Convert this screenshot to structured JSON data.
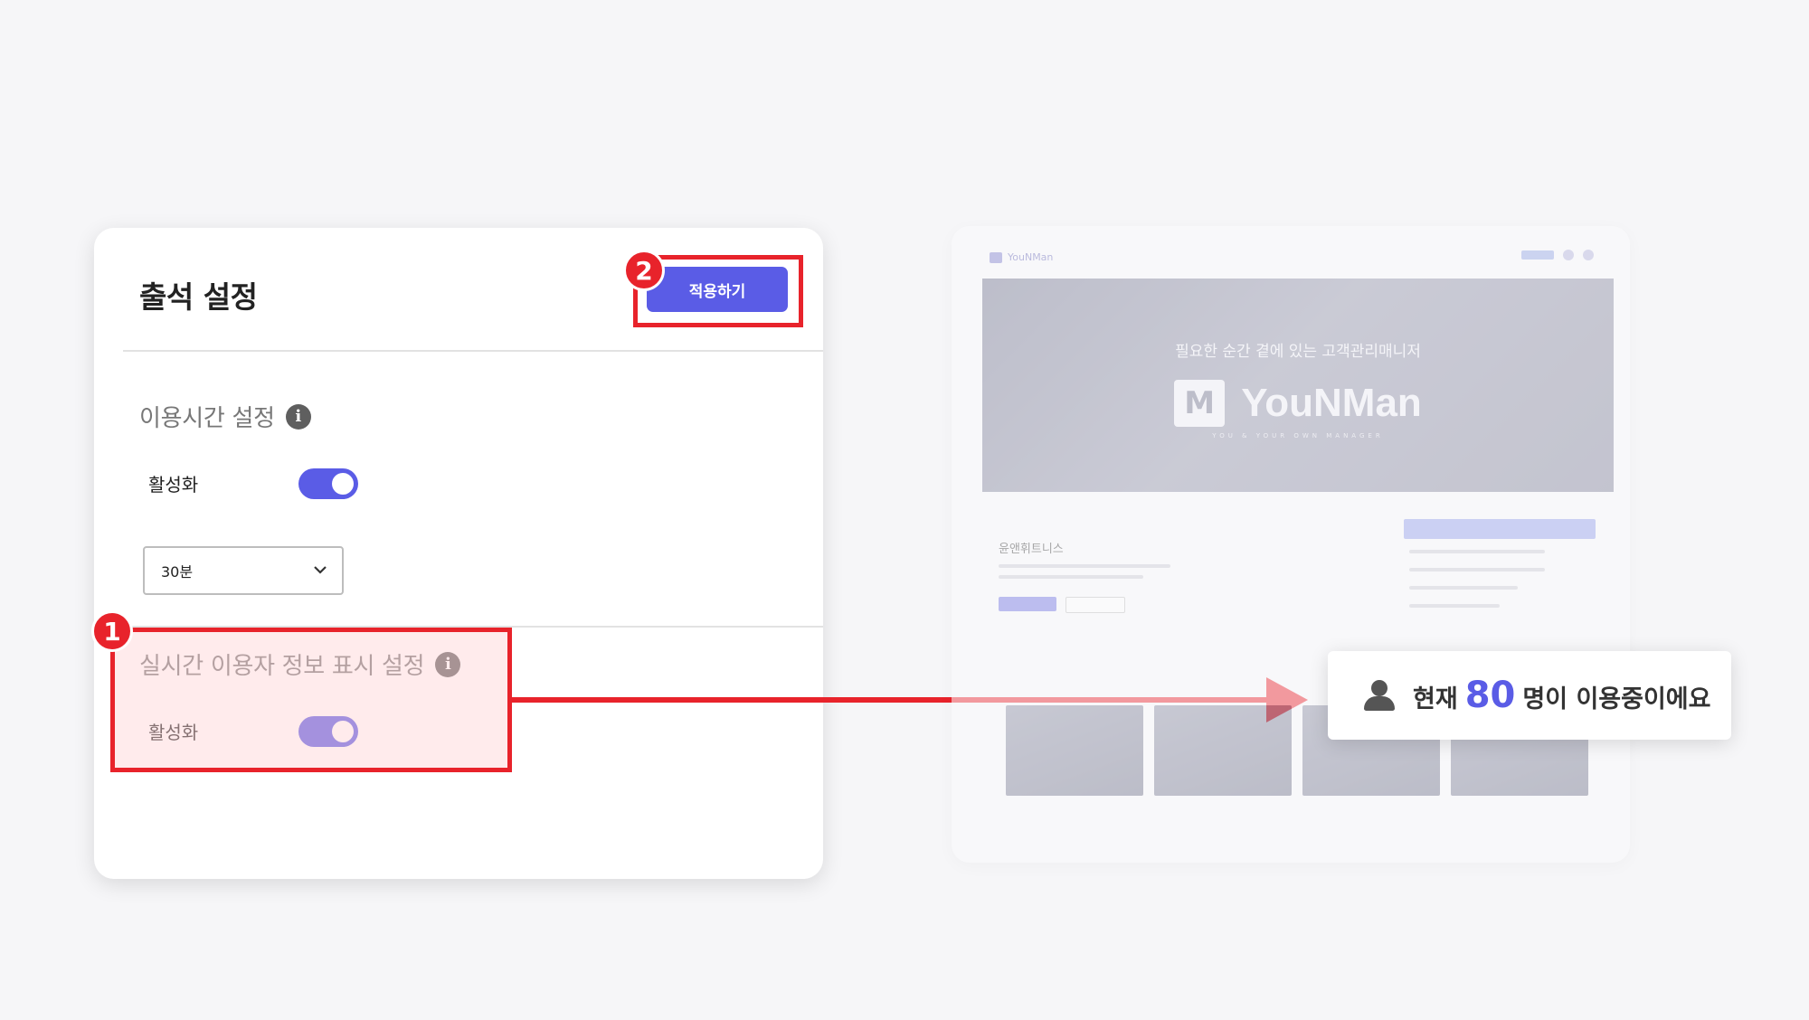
{
  "settings_card": {
    "title": "출석 설정",
    "apply_button": "적용하기",
    "usage_time": {
      "title": "이용시간 설정",
      "toggle_label": "활성화",
      "toggle_on": true,
      "select_value": "30분"
    },
    "realtime_user_info": {
      "title": "실시간 이용자 정보 표시 설정",
      "toggle_label": "활성화",
      "toggle_on": true
    }
  },
  "annotations": {
    "badge_1": "1",
    "badge_2": "2",
    "highlight_color": "#e8232b"
  },
  "preview": {
    "brand_small": "YouNMan",
    "hero_subtitle": "필요한 순간 곁에 있는 고객관리매니저",
    "hero_brand": "YouNMan",
    "hero_tagline": "YOU & YOUR OWN MANAGER",
    "center_name": "윤앤휘트니스"
  },
  "callout": {
    "prefix": "현재",
    "count": "80",
    "suffix": "명이 이용중이에요"
  },
  "colors": {
    "accent": "#5a5ce6",
    "highlight": "#e8232b"
  }
}
